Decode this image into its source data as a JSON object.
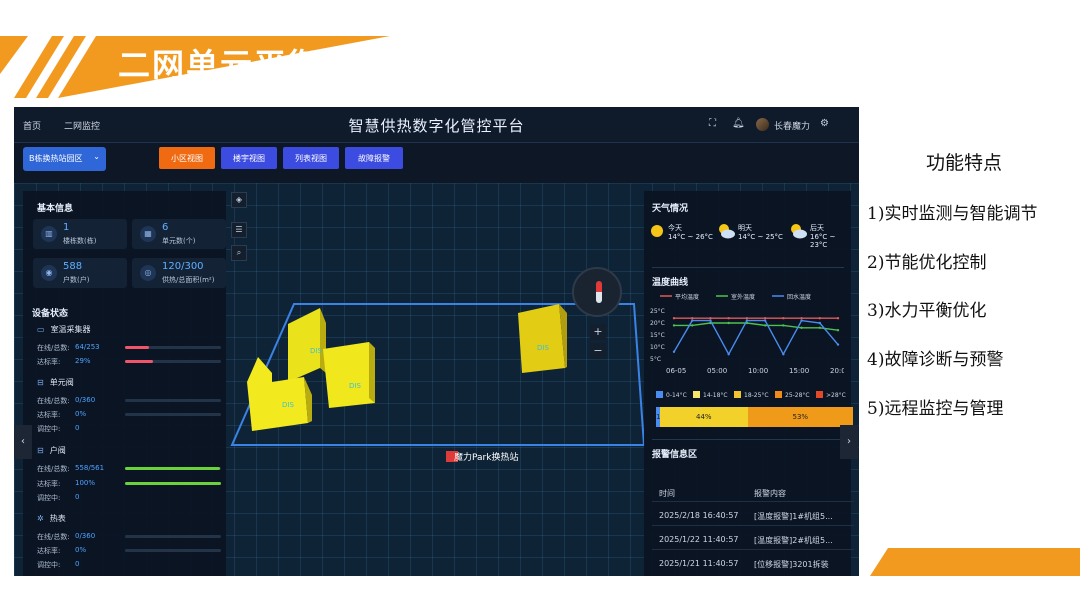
{
  "slide": {
    "title": "二网单元平衡系统",
    "features_title": "功能特点",
    "features": [
      "1)实时监测与智能调节",
      "2)节能优化控制",
      "3)水力平衡优化",
      "4)故障诊断与预警",
      "5)远程监控与管理"
    ],
    "colors": {
      "accent": "#f29a1f",
      "screen_bg": "#0b1624"
    }
  },
  "app": {
    "nav": [
      "首页",
      "二网监控"
    ],
    "title": "智慧供热数字化管控平台",
    "user": "长春魔力",
    "station_select": "B栋换热站园区",
    "tabs": [
      {
        "label": "小区视图",
        "active": true
      },
      {
        "label": "楼宇视图",
        "active": false
      },
      {
        "label": "列表视图",
        "active": false
      },
      {
        "label": "故障报警",
        "active": false
      }
    ]
  },
  "basic_info": {
    "title": "基本信息",
    "stats": [
      {
        "value": "1",
        "label": "楼栋数(栋)",
        "icon": "building-icon"
      },
      {
        "value": "6",
        "label": "单元数(个)",
        "icon": "grid-icon"
      },
      {
        "value": "588",
        "label": "户数(户)",
        "icon": "user-icon"
      },
      {
        "value": "120/300",
        "label": "供热/总面积(m²)",
        "icon": "area-icon"
      }
    ]
  },
  "device_status": {
    "title": "设备状态",
    "groups": [
      {
        "name": "室温采集器",
        "rows": [
          {
            "label": "在线/总数:",
            "value": "64/253",
            "fill": 0.25,
            "color": "#f0556a"
          },
          {
            "label": "达标率:",
            "value": "29%",
            "fill": 0.29,
            "color": "#f0556a"
          }
        ]
      },
      {
        "name": "单元阀",
        "rows": [
          {
            "label": "在线/总数:",
            "value": "0/360",
            "fill": 0,
            "color": "#4fd04f"
          },
          {
            "label": "达标率:",
            "value": "0%",
            "fill": 0,
            "color": "#4fd04f"
          },
          {
            "label": "调控中:",
            "value": "0"
          }
        ]
      },
      {
        "name": "户阀",
        "rows": [
          {
            "label": "在线/总数:",
            "value": "558/561",
            "fill": 0.99,
            "color": "#6ad23c"
          },
          {
            "label": "达标率:",
            "value": "100%",
            "fill": 1.0,
            "color": "#6ad23c"
          },
          {
            "label": "调控中:",
            "value": "0"
          }
        ]
      },
      {
        "name": "热表",
        "rows": [
          {
            "label": "在线/总数:",
            "value": "0/360",
            "fill": 0,
            "color": "#4fd04f"
          },
          {
            "label": "达标率:",
            "value": "0%",
            "fill": 0,
            "color": "#4fd04f"
          },
          {
            "label": "调控中:",
            "value": "0"
          }
        ]
      }
    ]
  },
  "map": {
    "buildings": [
      "DIS",
      "DIS",
      "DIS",
      "DIS",
      "DIS"
    ],
    "station_label": "魔力Park换热站"
  },
  "weather": {
    "title": "天气情况",
    "days": [
      {
        "day": "今天",
        "range": "14°C ~ 26°C",
        "icon": "sunny-icon"
      },
      {
        "day": "明天",
        "range": "14°C ~ 25°C",
        "icon": "partly-cloudy-icon"
      },
      {
        "day": "后天",
        "range": "16°C ~ 23°C",
        "icon": "partly-cloudy-icon"
      }
    ]
  },
  "temp_curve": {
    "title": "温度曲线",
    "chart_data": {
      "type": "line",
      "x_ticks": [
        "06-05",
        "05:00",
        "10:00",
        "15:00",
        "20:00"
      ],
      "y_ticks": [
        "25°C",
        "20°C",
        "15°C",
        "10°C",
        "5°C"
      ],
      "ylim": [
        5,
        25
      ],
      "series": [
        {
          "name": "平均温度",
          "color": "#e05a5a",
          "values": [
            22,
            22,
            22,
            22,
            22,
            22,
            22,
            22,
            22,
            22
          ]
        },
        {
          "name": "室外温度",
          "color": "#4fc04f",
          "values": [
            19,
            19,
            20,
            20,
            20,
            19,
            19,
            18,
            18,
            17
          ]
        },
        {
          "name": "回水温度",
          "color": "#4a8df0",
          "values": [
            8,
            21,
            21,
            7,
            21,
            21,
            7,
            21,
            20,
            11
          ]
        }
      ]
    }
  },
  "temp_distribution": {
    "legend": [
      {
        "label": "0-14°C",
        "color": "#4a8df0"
      },
      {
        "label": "14-18°C",
        "color": "#f5e56a"
      },
      {
        "label": "18-25°C",
        "color": "#f2c230"
      },
      {
        "label": "25-28°C",
        "color": "#f08a1a"
      },
      {
        "label": ">28°C",
        "color": "#e04a2a"
      }
    ],
    "segments": [
      {
        "label": "1%",
        "pct": 1,
        "color": "#4a8df0"
      },
      {
        "label": "44%",
        "pct": 44,
        "color": "#f2d22a"
      },
      {
        "label": "53%",
        "pct": 53,
        "color": "#f09a1a"
      }
    ]
  },
  "alarms": {
    "title": "报警信息区",
    "headers": [
      "时间",
      "报警内容"
    ],
    "rows": [
      {
        "time": "2025/2/18 16:40:57",
        "content": "[温度报警]1#机组5..."
      },
      {
        "time": "2025/1/22 11:40:57",
        "content": "[温度报警]2#机组5..."
      },
      {
        "time": "2025/1/21 11:40:57",
        "content": "[位移报警]3201拆装"
      }
    ]
  }
}
